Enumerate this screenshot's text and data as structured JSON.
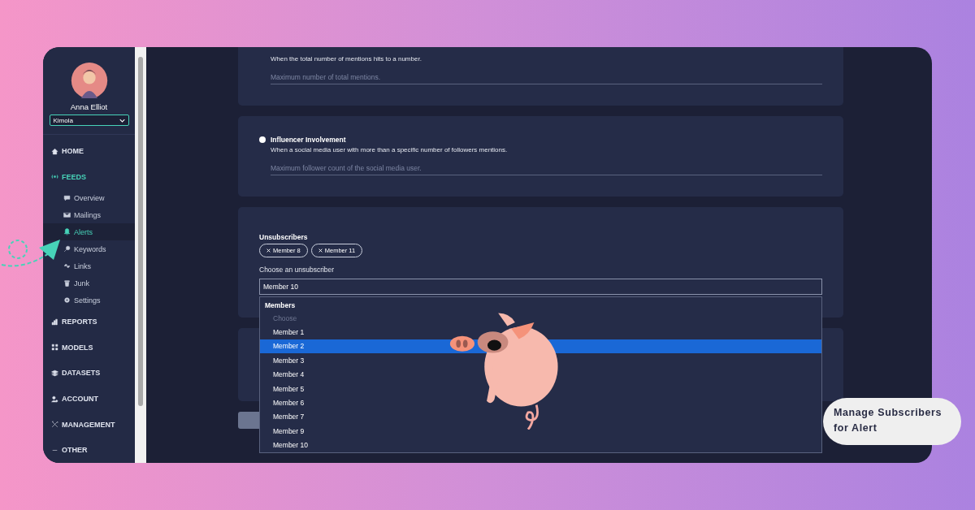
{
  "sidebar": {
    "user": {
      "name": "Anna Elliot"
    },
    "workspace": {
      "value": "Kimola"
    },
    "items": [
      {
        "label": "HOME",
        "kind": "section",
        "selected": false
      },
      {
        "label": "FEEDS",
        "kind": "section",
        "selected": true
      },
      {
        "label": "Overview",
        "kind": "sub",
        "selected": false
      },
      {
        "label": "Mailings",
        "kind": "sub",
        "selected": false
      },
      {
        "label": "Alerts",
        "kind": "sub",
        "selected": true
      },
      {
        "label": "Keywords",
        "kind": "sub",
        "selected": false
      },
      {
        "label": "Links",
        "kind": "sub",
        "selected": false
      },
      {
        "label": "Junk",
        "kind": "sub",
        "selected": false
      },
      {
        "label": "Settings",
        "kind": "sub",
        "selected": false
      },
      {
        "label": "REPORTS",
        "kind": "section",
        "selected": false
      },
      {
        "label": "MODELS",
        "kind": "section",
        "selected": false
      },
      {
        "label": "DATASETS",
        "kind": "section",
        "selected": false
      },
      {
        "label": "ACCOUNT",
        "kind": "section",
        "selected": false
      },
      {
        "label": "MANAGEMENT",
        "kind": "section",
        "selected": false
      },
      {
        "label": "OTHER",
        "kind": "section",
        "selected": false
      }
    ]
  },
  "alert_types": [
    {
      "description": "When the total number of mentions hits to a number.",
      "placeholder": "Maximum number of total mentions."
    },
    {
      "title": "Influencer Involvement",
      "selected": false,
      "description": "When a social media user with more than a specific number of followers mentions.",
      "placeholder": "Maximum follower count of the social media user."
    }
  ],
  "unsubscribers": {
    "title": "Unsubscribers",
    "chips": [
      {
        "label": "Member 8"
      },
      {
        "label": "Member 11"
      }
    ],
    "field_label": "Choose an unsubscriber",
    "value": "Member 10",
    "dropdown": {
      "group": "Members",
      "options": [
        {
          "label": "Choose",
          "disabled": true,
          "selected": false
        },
        {
          "label": "Member 1",
          "disabled": false,
          "selected": false
        },
        {
          "label": "Member 2",
          "disabled": false,
          "selected": true
        },
        {
          "label": "Member 3",
          "disabled": false,
          "selected": false
        },
        {
          "label": "Member 4",
          "disabled": false,
          "selected": false
        },
        {
          "label": "Member 5",
          "disabled": false,
          "selected": false
        },
        {
          "label": "Member 6",
          "disabled": false,
          "selected": false
        },
        {
          "label": "Member 7",
          "disabled": false,
          "selected": false
        },
        {
          "label": "Member 9",
          "disabled": false,
          "selected": false
        },
        {
          "label": "Member 10",
          "disabled": false,
          "selected": false
        }
      ]
    }
  },
  "callout": {
    "text": "Manage Subscribers for Alert"
  }
}
